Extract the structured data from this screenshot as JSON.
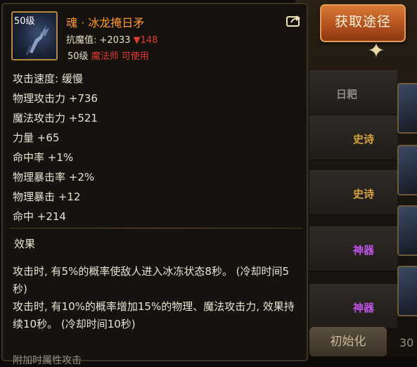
{
  "background": {
    "rows": [
      {
        "tag": "日耙",
        "color": "#8c8a86"
      },
      {
        "tag": "史诗",
        "color": "#d7a53a"
      },
      {
        "tag": "史诗",
        "color": "#d7a53a"
      },
      {
        "tag": "神器",
        "color": "#c054e8"
      },
      {
        "tag": "神器",
        "color": "#c054e8"
      }
    ],
    "reset_button": "初始化",
    "edge_digits": "30"
  },
  "acquire_button": "获取途径",
  "item": {
    "level_badge": "50级",
    "name": "魂 · 冰龙掩日矛",
    "resist_label": "抗魔值: ",
    "resist_value": "+2033",
    "resist_diff": "▼148",
    "req_level": "50级",
    "req_class": "魔法师 可使用"
  },
  "stats": [
    "攻击速度: 缓慢",
    "物理攻击力 +736",
    "魔法攻击力 +521",
    "力量 +65",
    "命中率 +1%",
    "物理暴击率 +2%",
    "物理暴击 +12",
    "命中 +214"
  ],
  "effect": {
    "title": "效果",
    "lines": [
      "攻击时, 有5%的概率使敌人进入冰冻状态8秒。 (冷却时间5秒)",
      "攻击时, 有10%的概率增加15%的物理、魔法攻击力, 效果持续10秒。 (冷却时间10秒)"
    ],
    "truncated_line": "附加时属性攻击"
  },
  "colors": {
    "name": "#ff9a1a",
    "negative": "#e23a2e",
    "text": "#e9e3d2",
    "button": "#c4601f"
  }
}
